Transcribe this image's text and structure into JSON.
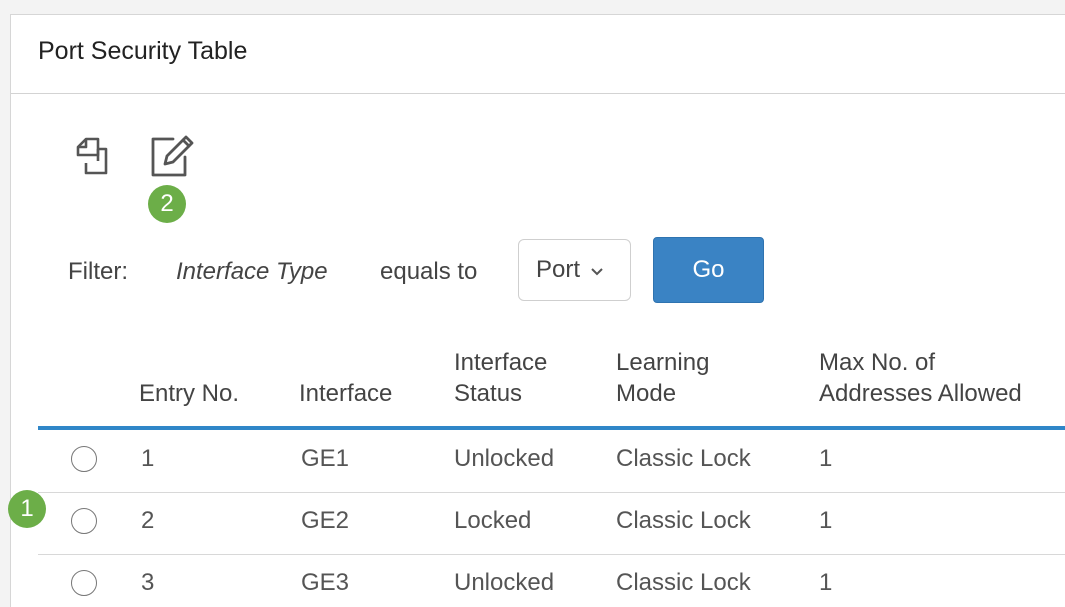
{
  "panel": {
    "title": "Port Security Table"
  },
  "toolbar": {
    "copy_icon": "copy-icon",
    "edit_icon": "edit-icon"
  },
  "annotations": {
    "badge_1": "1",
    "badge_2": "2",
    "color": "#6cae48"
  },
  "filter": {
    "label": "Filter:",
    "field": "Interface Type",
    "operator": "equals to",
    "selected": "Port",
    "go_label": "Go"
  },
  "table": {
    "headers": {
      "entry_no": "Entry No.",
      "interface": "Interface",
      "interface_status_line1": "Interface",
      "interface_status_line2": "Status",
      "learning_mode_line1": "Learning",
      "learning_mode_line2": "Mode",
      "max_line1": "Max No. of",
      "max_line2": "Addresses Allowed"
    },
    "rows": [
      {
        "entry": "1",
        "interface": "GE1",
        "status": "Unlocked",
        "mode": "Classic Lock",
        "max": "1"
      },
      {
        "entry": "2",
        "interface": "GE2",
        "status": "Locked",
        "mode": "Classic Lock",
        "max": "1"
      },
      {
        "entry": "3",
        "interface": "GE3",
        "status": "Unlocked",
        "mode": "Classic Lock",
        "max": "1"
      }
    ]
  },
  "colors": {
    "accent": "#2f86c8",
    "button": "#3a83c4"
  }
}
